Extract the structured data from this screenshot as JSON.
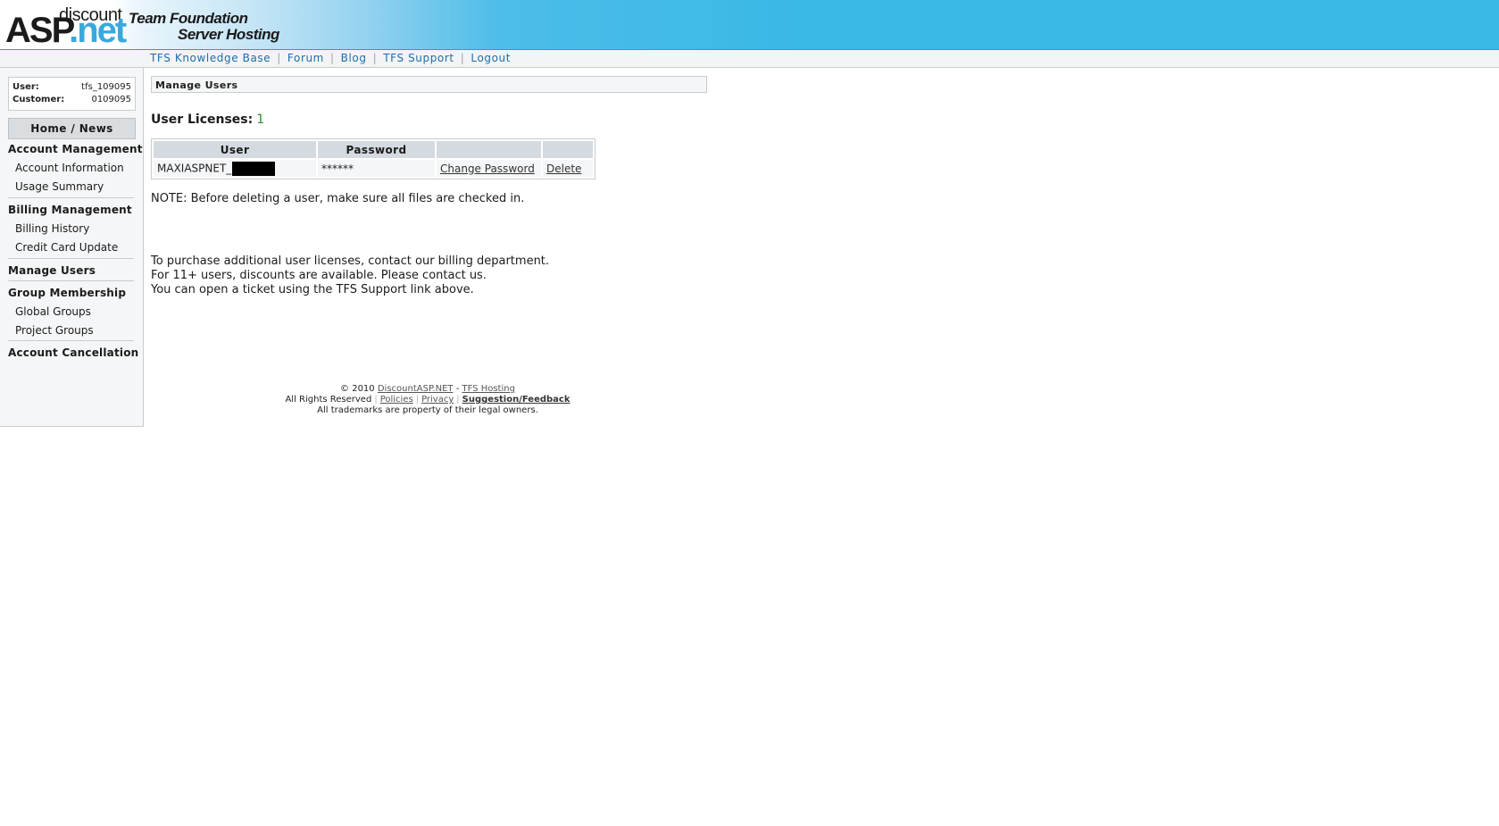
{
  "header": {
    "logo_top": "discount",
    "logo_main_a": "ASP",
    "logo_main_b": ".net",
    "tagline_1": "Team Foundation",
    "tagline_2": "Server Hosting"
  },
  "topnav": {
    "links": [
      "TFS Knowledge Base",
      "Forum",
      "Blog",
      "TFS Support",
      "Logout"
    ]
  },
  "sidebar": {
    "user_label": "User:",
    "user_value": "tfs_109095",
    "customer_label": "Customer:",
    "customer_value": "0109095",
    "home": "Home / News",
    "account_management": "Account Management",
    "account_information": "Account Information",
    "usage_summary": "Usage Summary",
    "billing_management": "Billing Management",
    "billing_history": "Billing History",
    "credit_card_update": "Credit Card Update",
    "manage_users": "Manage Users",
    "group_membership": "Group Membership",
    "global_groups": "Global Groups",
    "project_groups": "Project Groups",
    "account_cancellation": "Account Cancellation"
  },
  "main": {
    "title": "Manage Users",
    "licenses_label": "User Licenses:",
    "licenses_count": "1",
    "table": {
      "headers": [
        "User",
        "Password",
        "",
        ""
      ],
      "rows": [
        {
          "user": "MAXIASPNET_",
          "password": "******",
          "change": "Change Password",
          "delete": "Delete"
        }
      ]
    },
    "note": "NOTE: Before deleting a user, make sure all files are checked in.",
    "purchase_lines": [
      "To purchase additional user licenses, contact our billing department.",
      "For 11+ users, discounts are available. Please contact us.",
      "You can open a ticket using the TFS Support link above."
    ]
  },
  "footer": {
    "copyright": "© 2010",
    "discountasp": "DiscountASP.NET",
    "dash": "-",
    "tfs_hosting": "TFS Hosting",
    "rights": "All Rights Reserved",
    "policies": "Policies",
    "privacy": "Privacy",
    "feedback": "Suggestion/Feedback",
    "trademarks": "All trademarks are property of their legal owners."
  },
  "colors": {
    "header_blue": "#3ab8e6",
    "link_blue": "#1f6ea8",
    "license_green": "#2e8b2e"
  }
}
